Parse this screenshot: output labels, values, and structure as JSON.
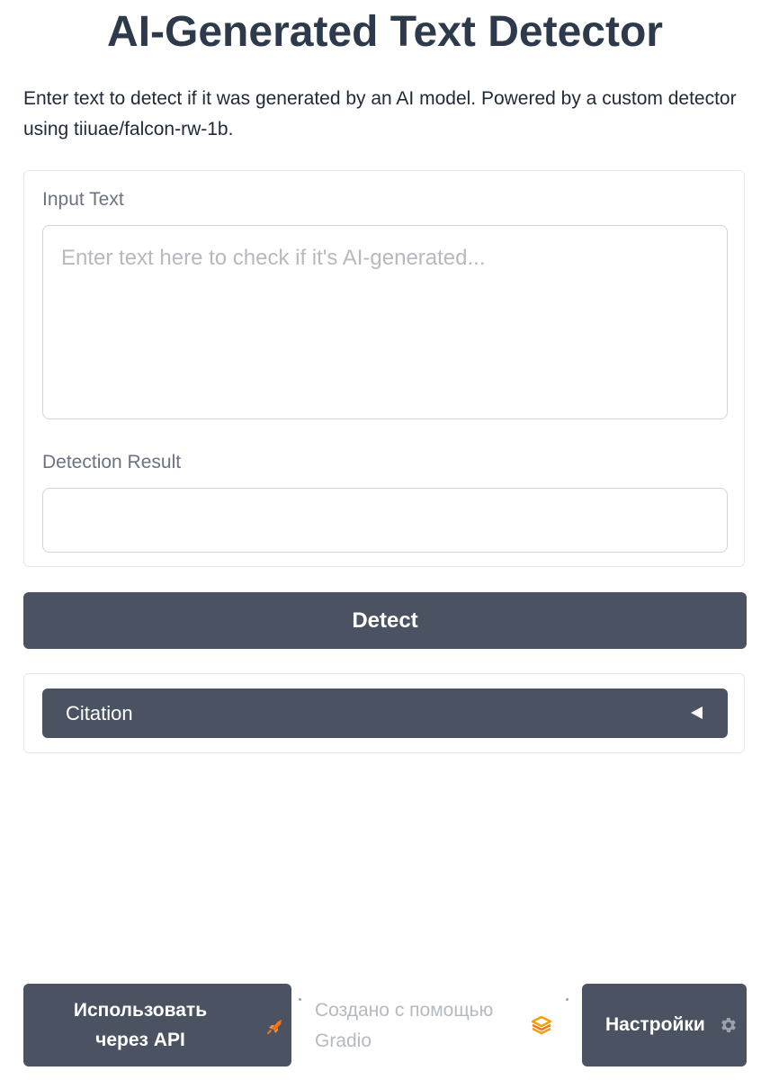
{
  "header": {
    "title": "AI-Generated Text Detector",
    "description": "Enter text to detect if it was generated by an AI model. Powered by a custom detector using tiiuae/falcon-rw-1b."
  },
  "form": {
    "input_label": "Input Text",
    "input_placeholder": "Enter text here to check if it's AI-generated...",
    "input_value": "",
    "result_label": "Detection Result",
    "result_value": ""
  },
  "actions": {
    "detect_label": "Detect"
  },
  "citation": {
    "label": "Citation",
    "expanded": false
  },
  "footer": {
    "api_label": "Использовать через API",
    "built_with_label": "Создано с помощью Gradio",
    "settings_label": "Настройки"
  },
  "icons": {
    "api": "rocket-icon",
    "gradio": "gradio-logo-icon",
    "settings": "gear-icon",
    "accordion": "triangle-left-icon"
  },
  "colors": {
    "primary_button": "#4b5261",
    "title": "#2d3a4b",
    "accent_orange": "#f97316"
  }
}
